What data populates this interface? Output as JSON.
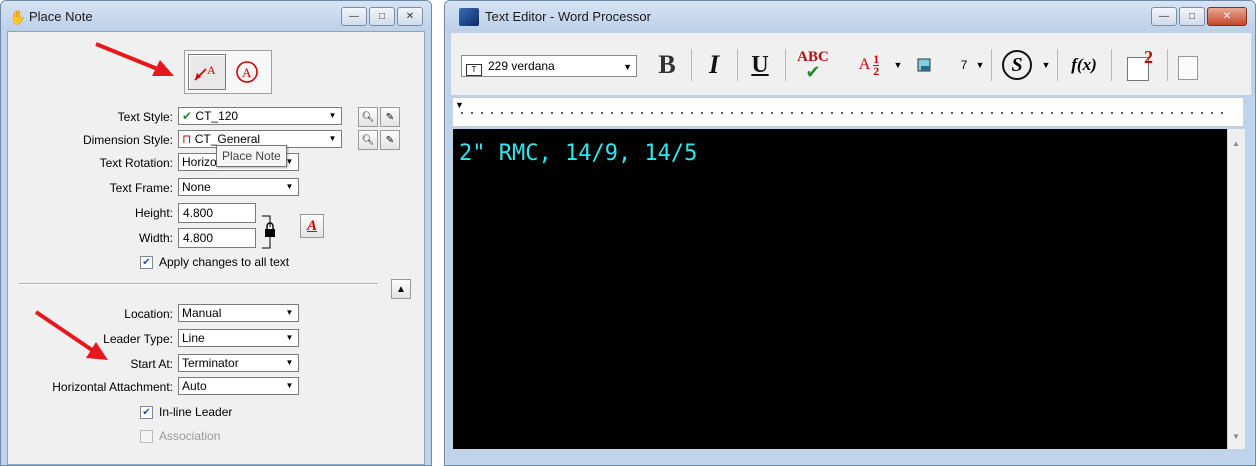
{
  "place_note": {
    "title": "Place Note",
    "tooltip": "Place Note",
    "fields": {
      "text_style": {
        "label": "Text Style:",
        "value": "CT_120"
      },
      "dimension_style": {
        "label": "Dimension Style:",
        "value": "CT_General"
      },
      "text_rotation": {
        "label": "Text Rotation:",
        "value": "Horizontal"
      },
      "text_frame": {
        "label": "Text Frame:",
        "value": "None"
      },
      "height": {
        "label": "Height:",
        "value": "4.800"
      },
      "width": {
        "label": "Width:",
        "value": "4.800"
      },
      "apply_changes": {
        "label": "Apply changes to all text",
        "checked": true
      },
      "location": {
        "label": "Location:",
        "value": "Manual"
      },
      "leader_type": {
        "label": "Leader Type:",
        "value": "Line"
      },
      "start_at": {
        "label": "Start At:",
        "value": "Terminator"
      },
      "horizontal_attachment": {
        "label": "Horizontal Attachment:",
        "value": "Auto"
      },
      "inline_leader": {
        "label": "In-line Leader",
        "checked": true
      },
      "association": {
        "label": "Association",
        "checked": false,
        "enabled": false
      }
    }
  },
  "text_editor": {
    "title": "Text Editor - Word Processor",
    "font": "229 verdana",
    "size": "7",
    "buttons": {
      "bold": "B",
      "italic": "I",
      "underline": "U",
      "spell": "ABC",
      "fraction_a": "A",
      "fraction_num": "1",
      "fraction_den": "2",
      "symbol": "S",
      "formula": "f(x)",
      "superscript": "2"
    },
    "content": "2\" RMC, 14/9, 14/5"
  },
  "colors": {
    "editor_background": "#000000",
    "editor_text": "#2ee8ef",
    "arrow": "#e8171c"
  }
}
